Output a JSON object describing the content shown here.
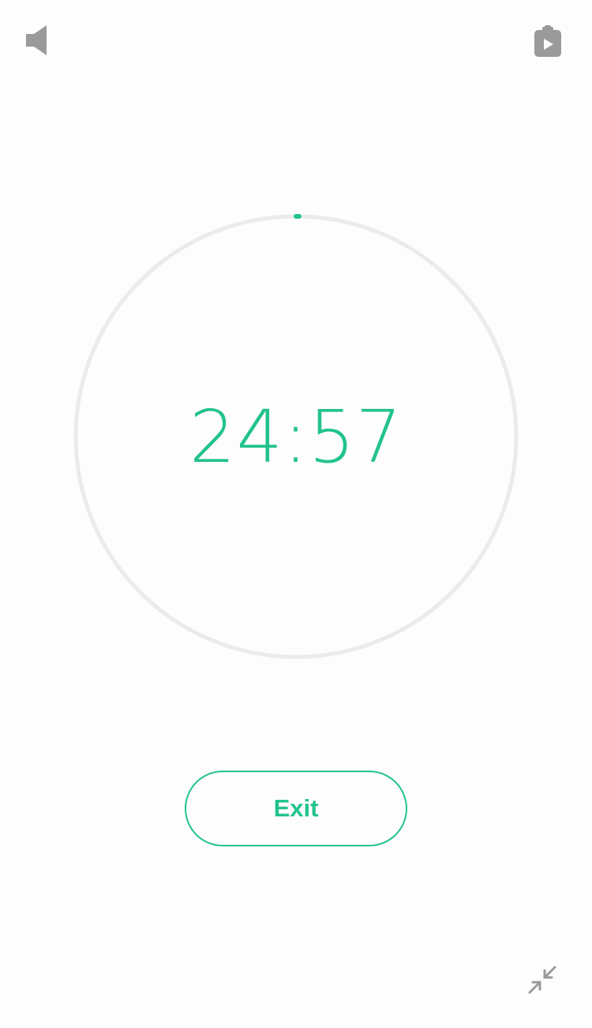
{
  "timer": {
    "display": "24:57",
    "progress": 0.002
  },
  "actions": {
    "exit_label": "Exit"
  },
  "icons": {
    "sound": "speaker-icon",
    "playlist": "clipboard-play-icon",
    "minimize": "collapse-arrows-icon"
  },
  "colors": {
    "accent": "#22c38a",
    "ring_track": "#ebebeb",
    "icon_gray": "#9a9a9a",
    "background": "#fdfdfd"
  }
}
